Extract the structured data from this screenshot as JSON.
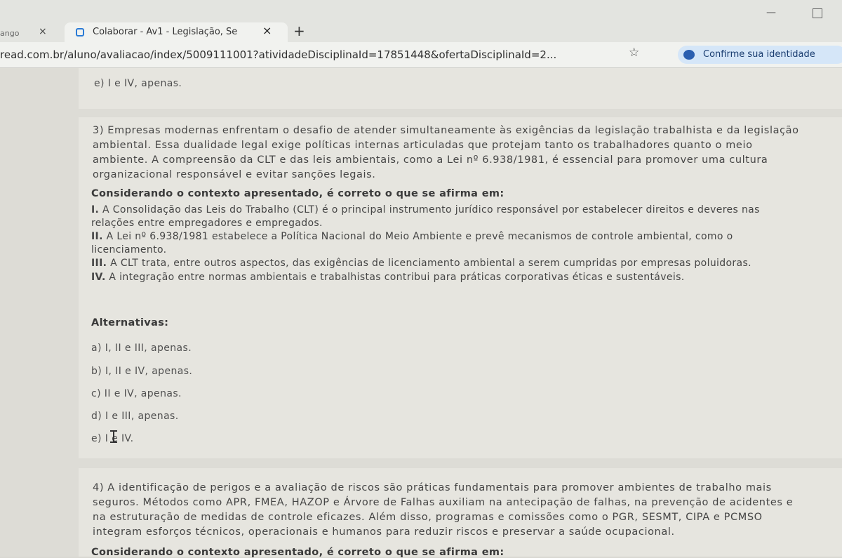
{
  "browser": {
    "tabs": [
      {
        "label": "ango",
        "close": "×"
      },
      {
        "label": "Colaborar - Av1 - Legislação, Se",
        "close": "×"
      }
    ],
    "new_tab": "+",
    "url": "read.com.br/aluno/avaliacao/index/5009111001?atividadeDisciplinaId=17851448&ofertaDisciplinaId=2...",
    "identity_button": "Confirme sua identidade",
    "window_minimize": "—"
  },
  "prev_option": "e) I e IV, apenas.",
  "question3": {
    "lines": [
      "3)  Empresas modernas enfrentam o desafio de atender simultaneamente às exigências da legislação trabalhista e da legislação",
      "ambiental. Essa dualidade legal exige políticas internas articuladas que protejam tanto os trabalhadores quanto o meio",
      "ambiente. A compreensão da CLT e das leis ambientais, como a Lei nº 6.938/1981, é essencial para promover uma cultura",
      "organizacional responsável e evitar sanções legais."
    ],
    "prompt": "Considerando o contexto apresentado, é correto o que se afirma em:",
    "statements": [
      {
        "num": "I.",
        "lines": [
          "A Consolidação das Leis do Trabalho (CLT) é o principal instrumento jurídico responsável por estabelecer direitos e deveres nas",
          "relações entre empregadores e empregados."
        ]
      },
      {
        "num": "II.",
        "lines": [
          "A Lei nº 6.938/1981 estabelece a Política Nacional do Meio Ambiente e prevê mecanismos de controle ambiental, como o",
          "licenciamento."
        ]
      },
      {
        "num": "III.",
        "lines": [
          "A CLT trata, entre outros aspectos, das exigências de licenciamento ambiental a serem cumpridas por empresas poluidoras."
        ]
      },
      {
        "num": "IV.",
        "lines": [
          "A integração entre normas ambientais e trabalhistas contribui para práticas corporativas éticas e sustentáveis."
        ]
      }
    ],
    "alternatives_title": "Alternativas:",
    "alternatives": [
      "a)  I, II e III, apenas.",
      "b)  I, II e IV, apenas.",
      "c)  II e IV, apenas.",
      "d)  I e III, apenas.",
      "e)  I e IV."
    ]
  },
  "question4": {
    "lines": [
      "4)  A identificação de perigos e a avaliação de riscos são práticas fundamentais para promover ambientes de trabalho mais",
      "seguros. Métodos como APR, FMEA, HAZOP e Árvore de Falhas auxiliam na antecipação de falhas, na prevenção de acidentes e",
      "na estruturação de medidas de controle eficazes. Além disso, programas e comissões como o PGR, SESMT, CIPA e PCMSO",
      "integram esforços técnicos, operacionais e humanos para reduzir riscos e preservar a saúde ocupacional."
    ],
    "partial_prompt": "Considerando o contexto apresentado, é correto o que se afirma em:"
  }
}
